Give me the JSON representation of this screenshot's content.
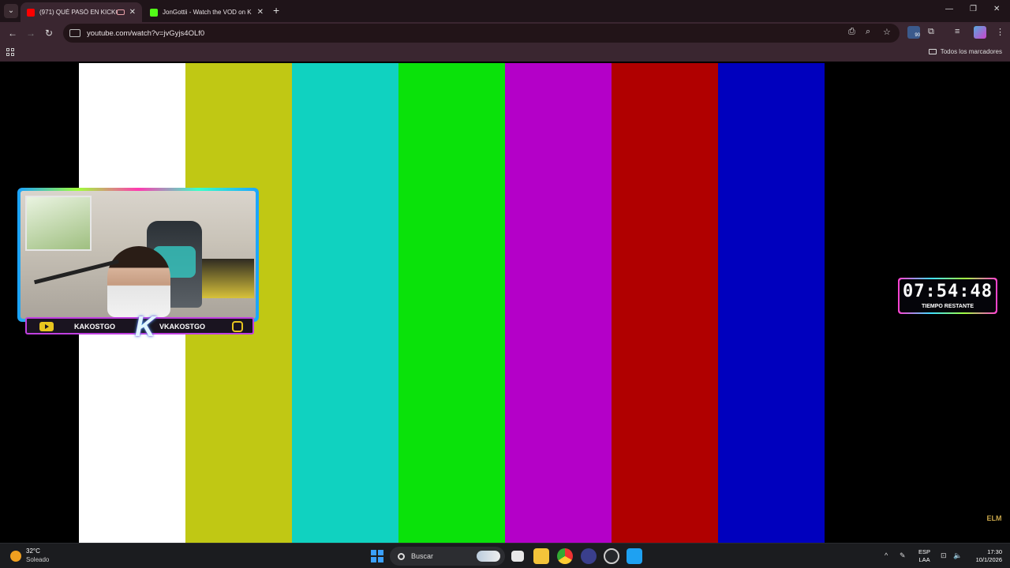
{
  "browser": {
    "tabs": [
      {
        "title": "(971) QUÉ PASÓ EN KICKC",
        "active": true,
        "favicon_color": "#ff0000"
      },
      {
        "title": "JonGottii - Watch the VOD on K",
        "active": false,
        "favicon_color": "#53fc18"
      }
    ],
    "new_tab_label": "+",
    "close_glyph": "✕",
    "url": "youtube.com/watch?v=jvGyjs4OLf0",
    "extension_badge": "90",
    "bookmarks_all_label": "Todos los marcadores"
  },
  "video": {
    "color_bars": [
      "#ffffff",
      "#c0c814",
      "#10d2c0",
      "#0ae20a",
      "#b400c8",
      "#b00000",
      "#0000be"
    ],
    "overlay": {
      "left_name": "KAKOSTGO",
      "right_name": "VKAKOSTGO",
      "logo_letter": "K"
    },
    "timer": {
      "value": "07:54:48",
      "label": "TIEMPO RESTANTE"
    },
    "watermark": "ELM"
  },
  "taskbar": {
    "weather_temp": "32°C",
    "weather_desc": "Soleado",
    "search_placeholder": "Buscar",
    "lang_line1": "ESP",
    "lang_line2": "LAA",
    "time": "17:30",
    "date": "10/1/2026"
  }
}
